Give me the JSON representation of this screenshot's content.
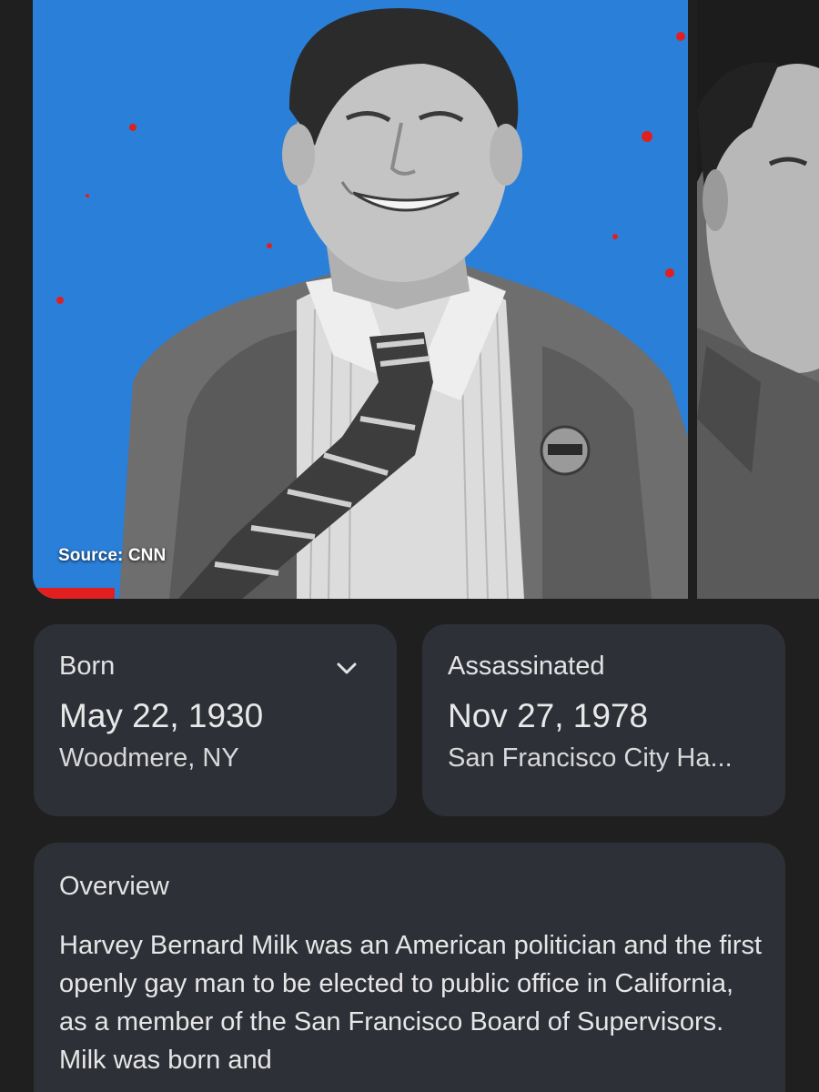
{
  "gallery": {
    "source_text": "Source: CNN",
    "background_color": "#2a7fd8",
    "accent_color": "#e02020"
  },
  "facts": {
    "born": {
      "label": "Born",
      "date": "May 22, 1930",
      "place": "Woodmere, NY",
      "icon": "chevron-down-icon"
    },
    "assassinated": {
      "label": "Assassinated",
      "date": "Nov 27, 1978",
      "place": "San Francisco City Ha..."
    }
  },
  "overview": {
    "title": "Overview",
    "text": "Harvey Bernard Milk was an American politician and the first openly gay man to be elected to public office in California, as a member of the San Francisco Board of Supervisors. Milk was born and"
  }
}
